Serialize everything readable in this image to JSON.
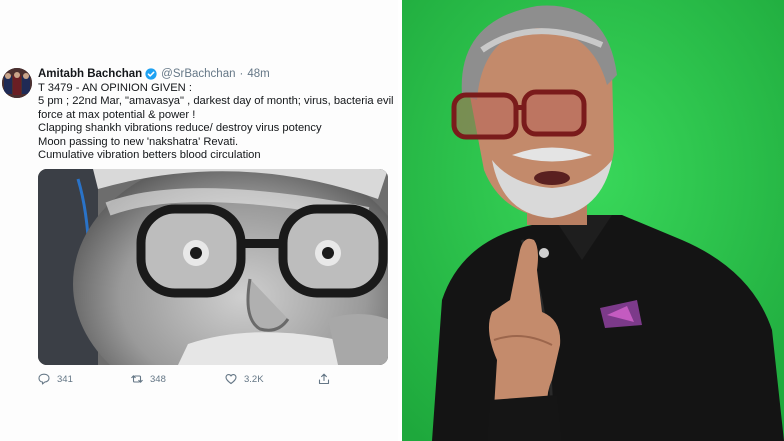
{
  "tweet": {
    "display_name": "Amitabh Bachchan",
    "handle": "@SrBachchan",
    "separator": "·",
    "time": "48m",
    "lines": [
      "T 3479 - AN OPINION GIVEN :",
      "5 pm ; 22nd Mar, \"amavasya\" , darkest day of month; virus, bacteria evil force at max potential & power !",
      "Clapping shankh vibrations reduce/ destroy virus potency",
      "Moon passing to new 'nakshatra' Revati.",
      "Cumulative vibration betters blood circulation"
    ],
    "actions": {
      "reply_count": "341",
      "retweet_count": "348",
      "like_count": "3.2K"
    }
  },
  "icons": {
    "verified": "verified-badge-icon",
    "reply": "reply-icon",
    "retweet": "retweet-icon",
    "like": "heart-icon",
    "share": "share-icon"
  },
  "colors": {
    "verified": "#1da1f2",
    "muted_text": "#657786",
    "green_screen": "#2bbf4a"
  }
}
